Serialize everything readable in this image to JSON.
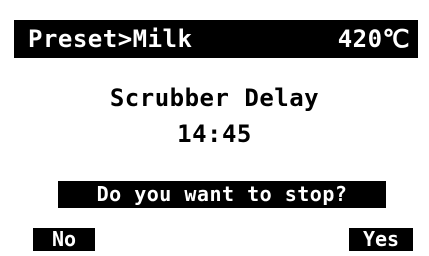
{
  "header": {
    "title": "Preset>Milk",
    "temperature": "420℃"
  },
  "main": {
    "process_name": "Scrubber Delay",
    "timer": "14:45"
  },
  "prompt": {
    "text": "Do you want to stop?"
  },
  "softkeys": {
    "left_label": "No",
    "right_label": "Yes"
  },
  "colors": {
    "foreground": "#000000",
    "background": "#ffffff"
  }
}
